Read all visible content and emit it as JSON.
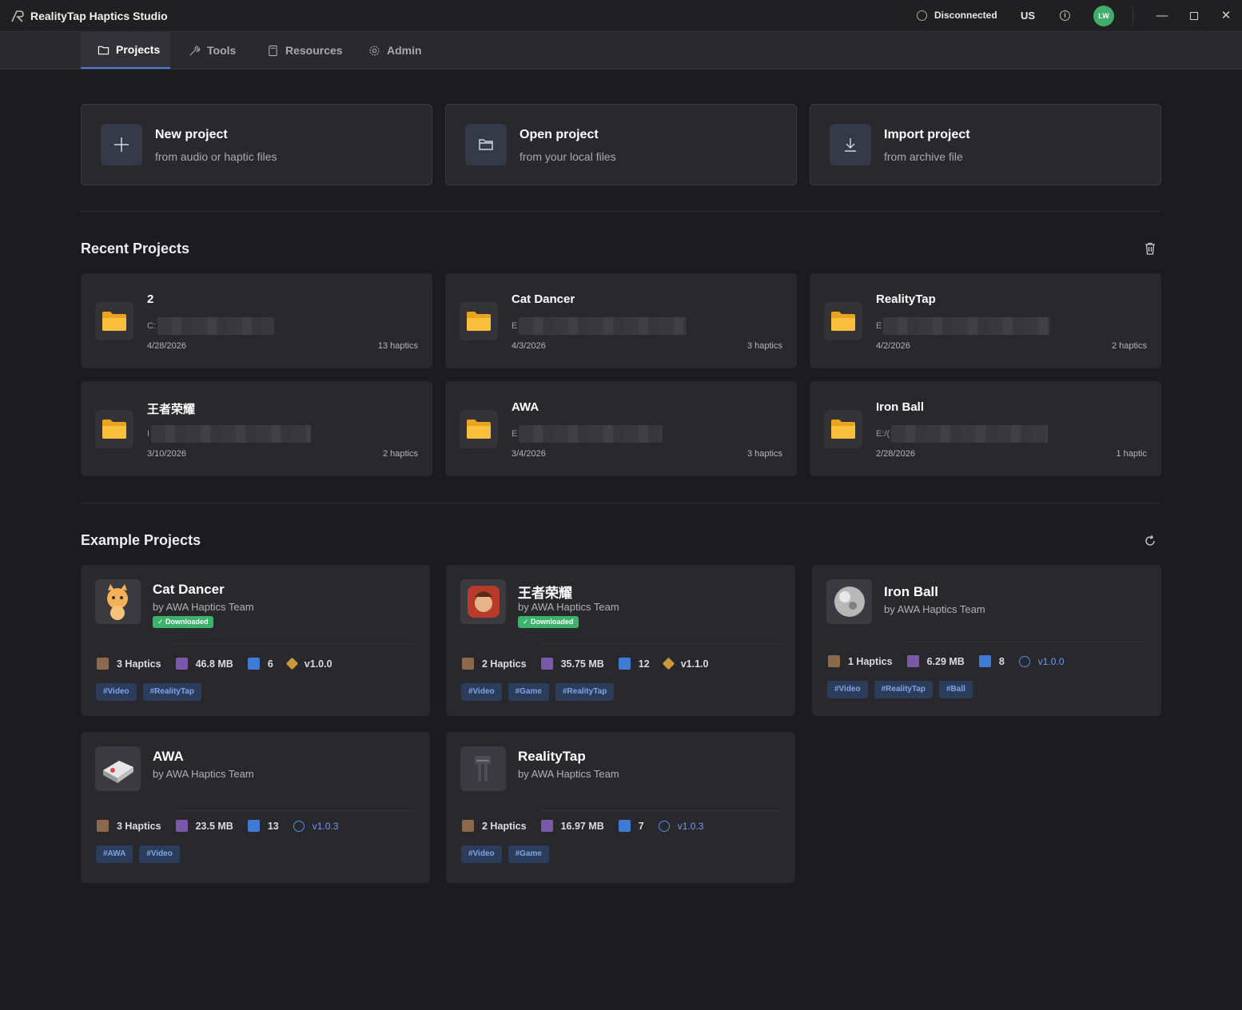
{
  "app": {
    "title": "RealityTap Haptics Studio"
  },
  "titlebar": {
    "connection_status": "Disconnected",
    "region": "US",
    "avatar_initials": "LW",
    "accent": "#3fae6b"
  },
  "nav": {
    "tabs": [
      {
        "label": "Projects",
        "icon": "folder-icon",
        "active": true
      },
      {
        "label": "Tools",
        "icon": "wrench-icon"
      },
      {
        "label": "Resources",
        "icon": "book-icon"
      },
      {
        "label": "Admin",
        "icon": "gear-icon"
      }
    ]
  },
  "actions": [
    {
      "title": "New project",
      "subtitle": "from audio or haptic files",
      "icon": "plus-icon"
    },
    {
      "title": "Open project",
      "subtitle": "from your local files",
      "icon": "folder-open-icon"
    },
    {
      "title": "Import project",
      "subtitle": "from archive file",
      "icon": "download-icon"
    }
  ],
  "recent": {
    "title": "Recent Projects",
    "items": [
      {
        "name": "2",
        "path_prefix": "C:",
        "date": "4/28/2026",
        "count": "13 haptics"
      },
      {
        "name": "Cat Dancer",
        "path_prefix": "E",
        "date": "4/3/2026",
        "count": "3 haptics"
      },
      {
        "name": "RealityTap",
        "path_prefix": "E",
        "date": "4/2/2026",
        "count": "2 haptics"
      },
      {
        "name": "王者荣耀",
        "path_prefix": "I",
        "date": "3/10/2026",
        "count": "2 haptics"
      },
      {
        "name": "AWA",
        "path_prefix": "E",
        "date": "3/4/2026",
        "count": "3 haptics"
      },
      {
        "name": "Iron Ball",
        "path_prefix": "E:/(",
        "date": "2/28/2026",
        "count": "1 haptic"
      }
    ]
  },
  "examples": {
    "title": "Example Projects",
    "items": [
      {
        "name": "Cat Dancer",
        "author": "by AWA Haptics Team",
        "badge": "✓ Downloaded",
        "haptics": "3 Haptics",
        "size": "46.8 MB",
        "downloads": "6",
        "version": "v1.0.0",
        "tags": [
          "#Video",
          "#RealityTap"
        ]
      },
      {
        "name": "王者荣耀",
        "author": "by AWA Haptics Team",
        "badge": "✓ Downloaded",
        "haptics": "2 Haptics",
        "size": "35.75 MB",
        "downloads": "12",
        "version": "v1.1.0",
        "tags": [
          "#Video",
          "#Game",
          "#RealityTap"
        ]
      },
      {
        "name": "Iron Ball",
        "author": "by AWA Haptics Team",
        "badge": "",
        "haptics": "1 Haptics",
        "size": "6.29 MB",
        "downloads": "8",
        "version": "v1.0.0",
        "tags": [
          "#Video",
          "#RealityTap",
          "#Ball"
        ]
      },
      {
        "name": "AWA",
        "author": "by AWA Haptics Team",
        "badge": "",
        "haptics": "3 Haptics",
        "size": "23.5 MB",
        "downloads": "13",
        "version": "v1.0.3",
        "tags": [
          "#AWA",
          "#Video"
        ]
      },
      {
        "name": "RealityTap",
        "author": "by AWA Haptics Team",
        "badge": "",
        "haptics": "2 Haptics",
        "size": "16.97 MB",
        "downloads": "7",
        "version": "v1.0.3",
        "tags": [
          "#Video",
          "#Game"
        ]
      }
    ]
  }
}
